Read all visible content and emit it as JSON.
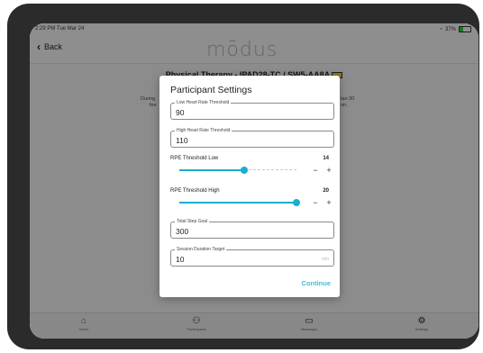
{
  "status_bar": {
    "time": "2:29 PM  Tue Mar 24",
    "battery": "37%",
    "battery_level": 0.37
  },
  "nav": {
    "back_label": "Back",
    "logo_text": "mōdus"
  },
  "page": {
    "title": "Physical Therapy - IPAD28-TC / SW5-AA8A",
    "bg_line1_left": "During",
    "bg_line2_left": "fee",
    "bg_line1_right": "tan 30",
    "bg_line2_right": "on."
  },
  "modal": {
    "title": "Participant Settings",
    "low_hr": {
      "label": "Low Heart Rate Threshold",
      "value": "90"
    },
    "high_hr": {
      "label": "High Heart Rate Threshold",
      "value": "110"
    },
    "rpe_low": {
      "label": "RPE Threshold Low",
      "value": "14",
      "level": 0.55
    },
    "rpe_high": {
      "label": "RPE Threshold High",
      "value": "20",
      "level": 1.0
    },
    "step_goal": {
      "label": "Total Step Goal",
      "value": "300"
    },
    "session_duration": {
      "label": "Session Duration Target",
      "value": "10",
      "unit_placeholder": "min"
    },
    "minus": "−",
    "plus": "+",
    "continue_label": "Continue"
  },
  "tabs": [
    {
      "label": "Home",
      "icon": "home-icon",
      "glyph": "⌂"
    },
    {
      "label": "Participants",
      "icon": "participants-icon",
      "glyph": "⚇"
    },
    {
      "label": "Messages",
      "icon": "message-icon",
      "glyph": "▭"
    },
    {
      "label": "Settings",
      "icon": "gear-icon",
      "glyph": "⚙"
    }
  ],
  "colors": {
    "accent": "#1aaed0",
    "continue": "#3ec0dc",
    "active_tab": "#1a6fa8"
  }
}
